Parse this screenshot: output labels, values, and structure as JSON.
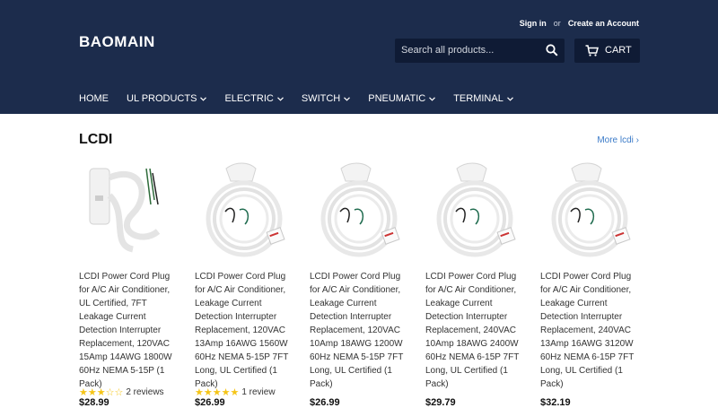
{
  "header": {
    "sign_in": "Sign in",
    "or": "or",
    "create_account": "Create an Account",
    "logo": "BAOMAIN",
    "search_placeholder": "Search all products...",
    "cart_label": "CART",
    "background": "#1c2c4c"
  },
  "nav": {
    "items": [
      {
        "label": "HOME",
        "dropdown": false
      },
      {
        "label": "UL PRODUCTS",
        "dropdown": true
      },
      {
        "label": "ELECTRIC",
        "dropdown": true
      },
      {
        "label": "SWITCH",
        "dropdown": true
      },
      {
        "label": "PNEUMATIC",
        "dropdown": true
      },
      {
        "label": "TERMINAL",
        "dropdown": true
      }
    ]
  },
  "section": {
    "title": "LCDI",
    "more_link": "More lcdi ›"
  },
  "products": [
    {
      "title": "LCDI Power Cord Plug for A/C Air Conditioner, UL Certified, 7FT Leakage Current Detection Interrupter Replacement, 120VAC 15Amp 14AWG 1800W 60Hz NEMA 5-15P (1 Pack)",
      "rating": 3,
      "reviews": "2 reviews",
      "price": "$28.99"
    },
    {
      "title": "LCDI Power Cord Plug for A/C Air Conditioner, Leakage Current Detection Interrupter Replacement, 120VAC 13Amp 16AWG 1560W 60Hz NEMA 5-15P 7FT Long, UL Certified (1 Pack)",
      "rating": 5,
      "reviews": "1 review",
      "price": "$26.99"
    },
    {
      "title": "LCDI Power Cord Plug for A/C Air Conditioner, Leakage Current Detection Interrupter Replacement, 120VAC 10Amp 18AWG 1200W 60Hz NEMA 5-15P 7FT Long, UL Certified (1 Pack)",
      "rating": null,
      "reviews": "",
      "price": "$26.99"
    },
    {
      "title": "LCDI Power Cord Plug for A/C Air Conditioner, Leakage Current Detection Interrupter Replacement, 240VAC 10Amp 18AWG 2400W 60Hz NEMA 6-15P 7FT Long, UL Certified (1 Pack)",
      "rating": null,
      "reviews": "",
      "price": "$29.79"
    },
    {
      "title": "LCDI Power Cord Plug for A/C Air Conditioner, Leakage Current Detection Interrupter Replacement, 240VAC 13Amp 16AWG 3120W 60Hz NEMA 6-15P 7FT Long, UL Certified (1 Pack)",
      "rating": null,
      "reviews": "",
      "price": "$32.19"
    }
  ]
}
